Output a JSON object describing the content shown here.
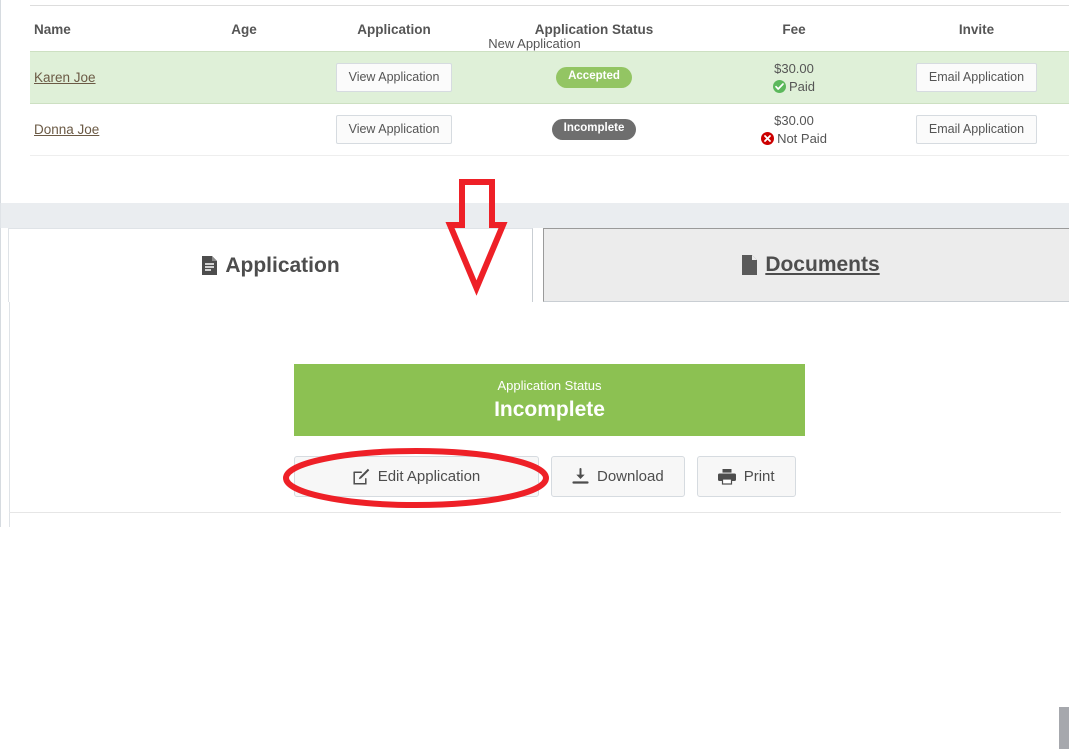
{
  "table": {
    "columns": [
      "Name",
      "Age",
      "Application",
      "Application Status",
      "Fee",
      "Invite"
    ],
    "rows": [
      {
        "name": "Karen Joe",
        "age": "",
        "application_button": "View Application",
        "status": "Accepted",
        "status_type": "accepted",
        "fee_amount": "$30.00",
        "fee_state": "Paid",
        "fee_state_type": "paid",
        "invite_button": "Email Application",
        "highlighted": true
      },
      {
        "name": "Donna Joe",
        "age": "",
        "application_button": "View Application",
        "status": "Incomplete",
        "status_type": "incomplete",
        "fee_amount": "$30.00",
        "fee_state": "Not Paid",
        "fee_state_type": "not-paid",
        "invite_button": "Email Application",
        "highlighted": false
      }
    ]
  },
  "tabs": [
    {
      "label": "Application",
      "icon": "document-lines-icon",
      "active": true
    },
    {
      "label": "Documents",
      "icon": "document-corner-icon",
      "active": false
    }
  ],
  "content": {
    "new_application_label": "New Application",
    "status_panel": {
      "caption": "Application Status",
      "value": "Incomplete",
      "color": "#8cc152"
    },
    "actions": [
      {
        "label": "Edit Application",
        "icon": "pencil-square-icon"
      },
      {
        "label": "Download",
        "icon": "download-icon"
      },
      {
        "label": "Print",
        "icon": "printer-icon"
      }
    ]
  },
  "annotations": {
    "arrow": {
      "shape": "down-arrow-outline",
      "color": "#ee2027"
    },
    "ellipse": {
      "shape": "ellipse-outline",
      "color": "#ee2027",
      "target": "Edit Application"
    }
  },
  "colors": {
    "accepted_badge": "#93c563",
    "incomplete_badge": "#6e6e6e",
    "row_highlight": "#dff0d8",
    "paid_mark": "#5cb85c",
    "notpaid_mark": "#cc0000",
    "annotation": "#ee2027"
  }
}
